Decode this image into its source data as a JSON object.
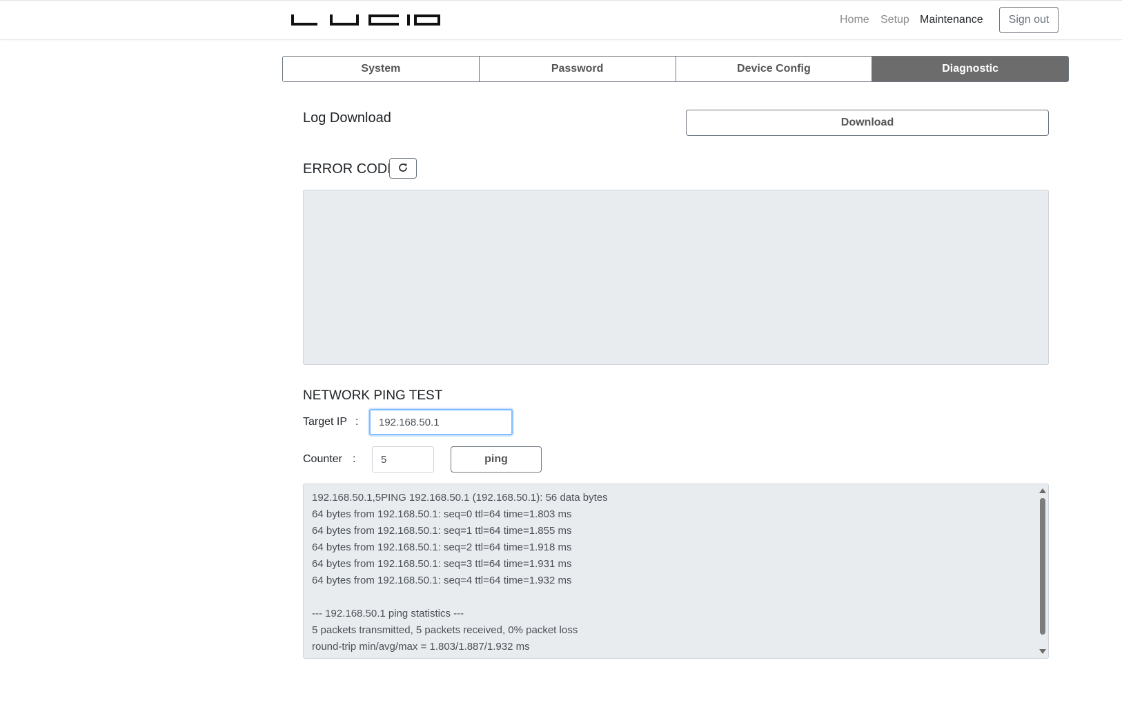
{
  "header": {
    "logo_text": "LUCID",
    "nav": [
      {
        "label": "Home"
      },
      {
        "label": "Setup"
      },
      {
        "label": "Maintenance"
      }
    ],
    "active_nav": "Maintenance",
    "sign_out_label": "Sign out"
  },
  "tabs": [
    {
      "label": "System"
    },
    {
      "label": "Password"
    },
    {
      "label": "Device Config"
    },
    {
      "label": "Diagnostic"
    }
  ],
  "active_tab": "Diagnostic",
  "log_download": {
    "title": "Log Download",
    "button_label": "Download"
  },
  "error_code": {
    "title": "ERROR CODE",
    "refresh_icon": "refresh-icon",
    "content": ""
  },
  "ping_test": {
    "title": "NETWORK PING TEST",
    "target_label": "Target IP",
    "target_colon": ":",
    "target_value": "192.168.50.1",
    "counter_label": "Counter",
    "counter_colon": ":",
    "counter_value": "5",
    "ping_button_label": "ping",
    "output_lines": [
      "192.168.50.1,5PING 192.168.50.1 (192.168.50.1): 56 data bytes",
      "64 bytes from 192.168.50.1: seq=0 ttl=64 time=1.803 ms",
      "64 bytes from 192.168.50.1: seq=1 ttl=64 time=1.855 ms",
      "64 bytes from 192.168.50.1: seq=2 ttl=64 time=1.918 ms",
      "64 bytes from 192.168.50.1: seq=3 ttl=64 time=1.931 ms",
      "64 bytes from 192.168.50.1: seq=4 ttl=64 time=1.932 ms",
      "",
      "--- 192.168.50.1 ping statistics ---",
      "5 packets transmitted, 5 packets received, 0% packet loss",
      "round-trip min/avg/max = 1.803/1.887/1.932 ms"
    ]
  },
  "colors": {
    "active_tab_bg": "#6c6c6c",
    "readonly_bg": "#e9ecef",
    "focus_border": "#80bdff",
    "muted_text": "#8a8a8a"
  }
}
